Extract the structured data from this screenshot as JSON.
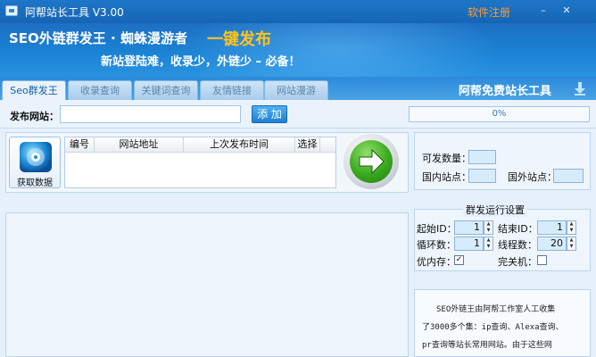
{
  "window": {
    "title": "阿帮站长工具 V3.00",
    "register_link": "软件注册",
    "minimize_glyph": "–",
    "close_glyph": "✕"
  },
  "banner": {
    "slogan_main": "SEO外链群发王 · 蜘蛛漫游者",
    "slogan_highlight": "一键发布",
    "slogan_sub": "新站登陆难，收录少，外链少 – 必备！",
    "highlight_color": "#ffc21f"
  },
  "tabs": [
    {
      "label": "Seo群发王",
      "active": true
    },
    {
      "label": "收录查询",
      "active": false
    },
    {
      "label": "关键词查询",
      "active": false
    },
    {
      "label": "友情链接",
      "active": false
    },
    {
      "label": "网站漫游",
      "active": false
    }
  ],
  "header_right": {
    "label": "阿帮免费站长工具",
    "icon": "download-arrow-icon"
  },
  "publish": {
    "label": "发布网站：",
    "input_value": "",
    "add_button": "添 加",
    "progress_percent": 0,
    "progress_text": "0%"
  },
  "fetch": {
    "label": "获取数据",
    "icon": "globe-disc-icon"
  },
  "site_table": {
    "columns": [
      "编号",
      "网站地址",
      "上次发布时间",
      "选择"
    ],
    "rows": []
  },
  "go_button": {
    "icon": "right-arrow-icon",
    "color": "#3aa91f"
  },
  "stats": {
    "available_label": "可发数量：",
    "available_value": "",
    "domestic_label": "国内站点：",
    "domestic_value": "",
    "foreign_label": "国外站点：",
    "foreign_value": ""
  },
  "settings": {
    "title": "群发运行设置",
    "start_id_label": "起始ID：",
    "start_id": "1",
    "end_id_label": "结束ID：",
    "end_id": "1",
    "loop_label": "循环数：",
    "loop": "1",
    "threads_label": "线程数：",
    "threads": "20",
    "optimize_memory_label": "优内存：",
    "optimize_memory_checked": true,
    "shutdown_label": "完关机：",
    "shutdown_checked": false,
    "check_mark": "✓"
  },
  "info": {
    "lines": [
      "SEO外链王由阿帮工作室人工收集",
      "了3000多个集：ip查询、Alexa查询、",
      "pr查询等站长常用网站。由于这些网"
    ]
  }
}
